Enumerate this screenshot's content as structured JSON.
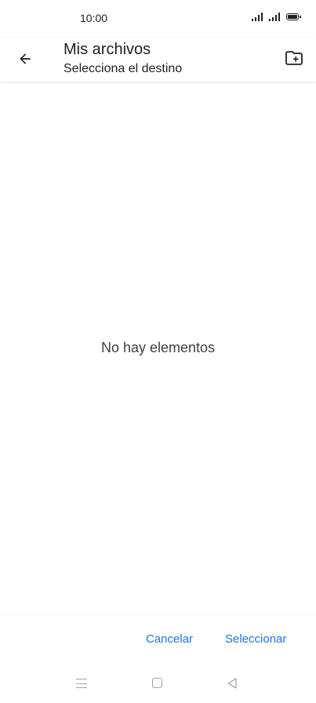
{
  "status_bar": {
    "time": "10:00"
  },
  "app_bar": {
    "title": "Mis archivos",
    "subtitle": "Selecciona el destino",
    "back_icon": "arrow-left-icon",
    "new_folder_icon": "create-new-folder-icon"
  },
  "content": {
    "empty_message": "No hay elementos"
  },
  "actions": {
    "cancel_label": "Cancelar",
    "select_label": "Seleccionar"
  },
  "colors": {
    "accent": "#1a73e8",
    "text_primary": "#202124",
    "nav_icons": "#9aa0a6"
  }
}
